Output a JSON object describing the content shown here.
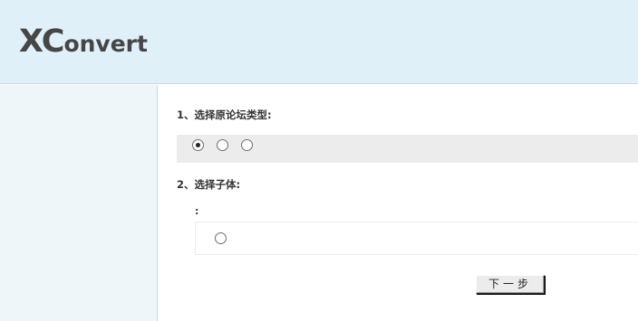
{
  "header": {
    "logo_big": "XC",
    "logo_small": "onvert"
  },
  "main": {
    "step1": {
      "title": "1、选择原论坛类型:",
      "options": [
        {
          "checked": true
        },
        {
          "checked": false
        },
        {
          "checked": false
        }
      ]
    },
    "step2": {
      "title": "2、选择子体:",
      "sub_label": ":",
      "options": [
        {
          "checked": false
        }
      ]
    },
    "next_button": "下一步"
  },
  "colors": {
    "header_bg": "#dff0f8",
    "sidebar_bg": "#eef6fa",
    "band_bg": "#ececec",
    "logo_text": "#464646"
  }
}
